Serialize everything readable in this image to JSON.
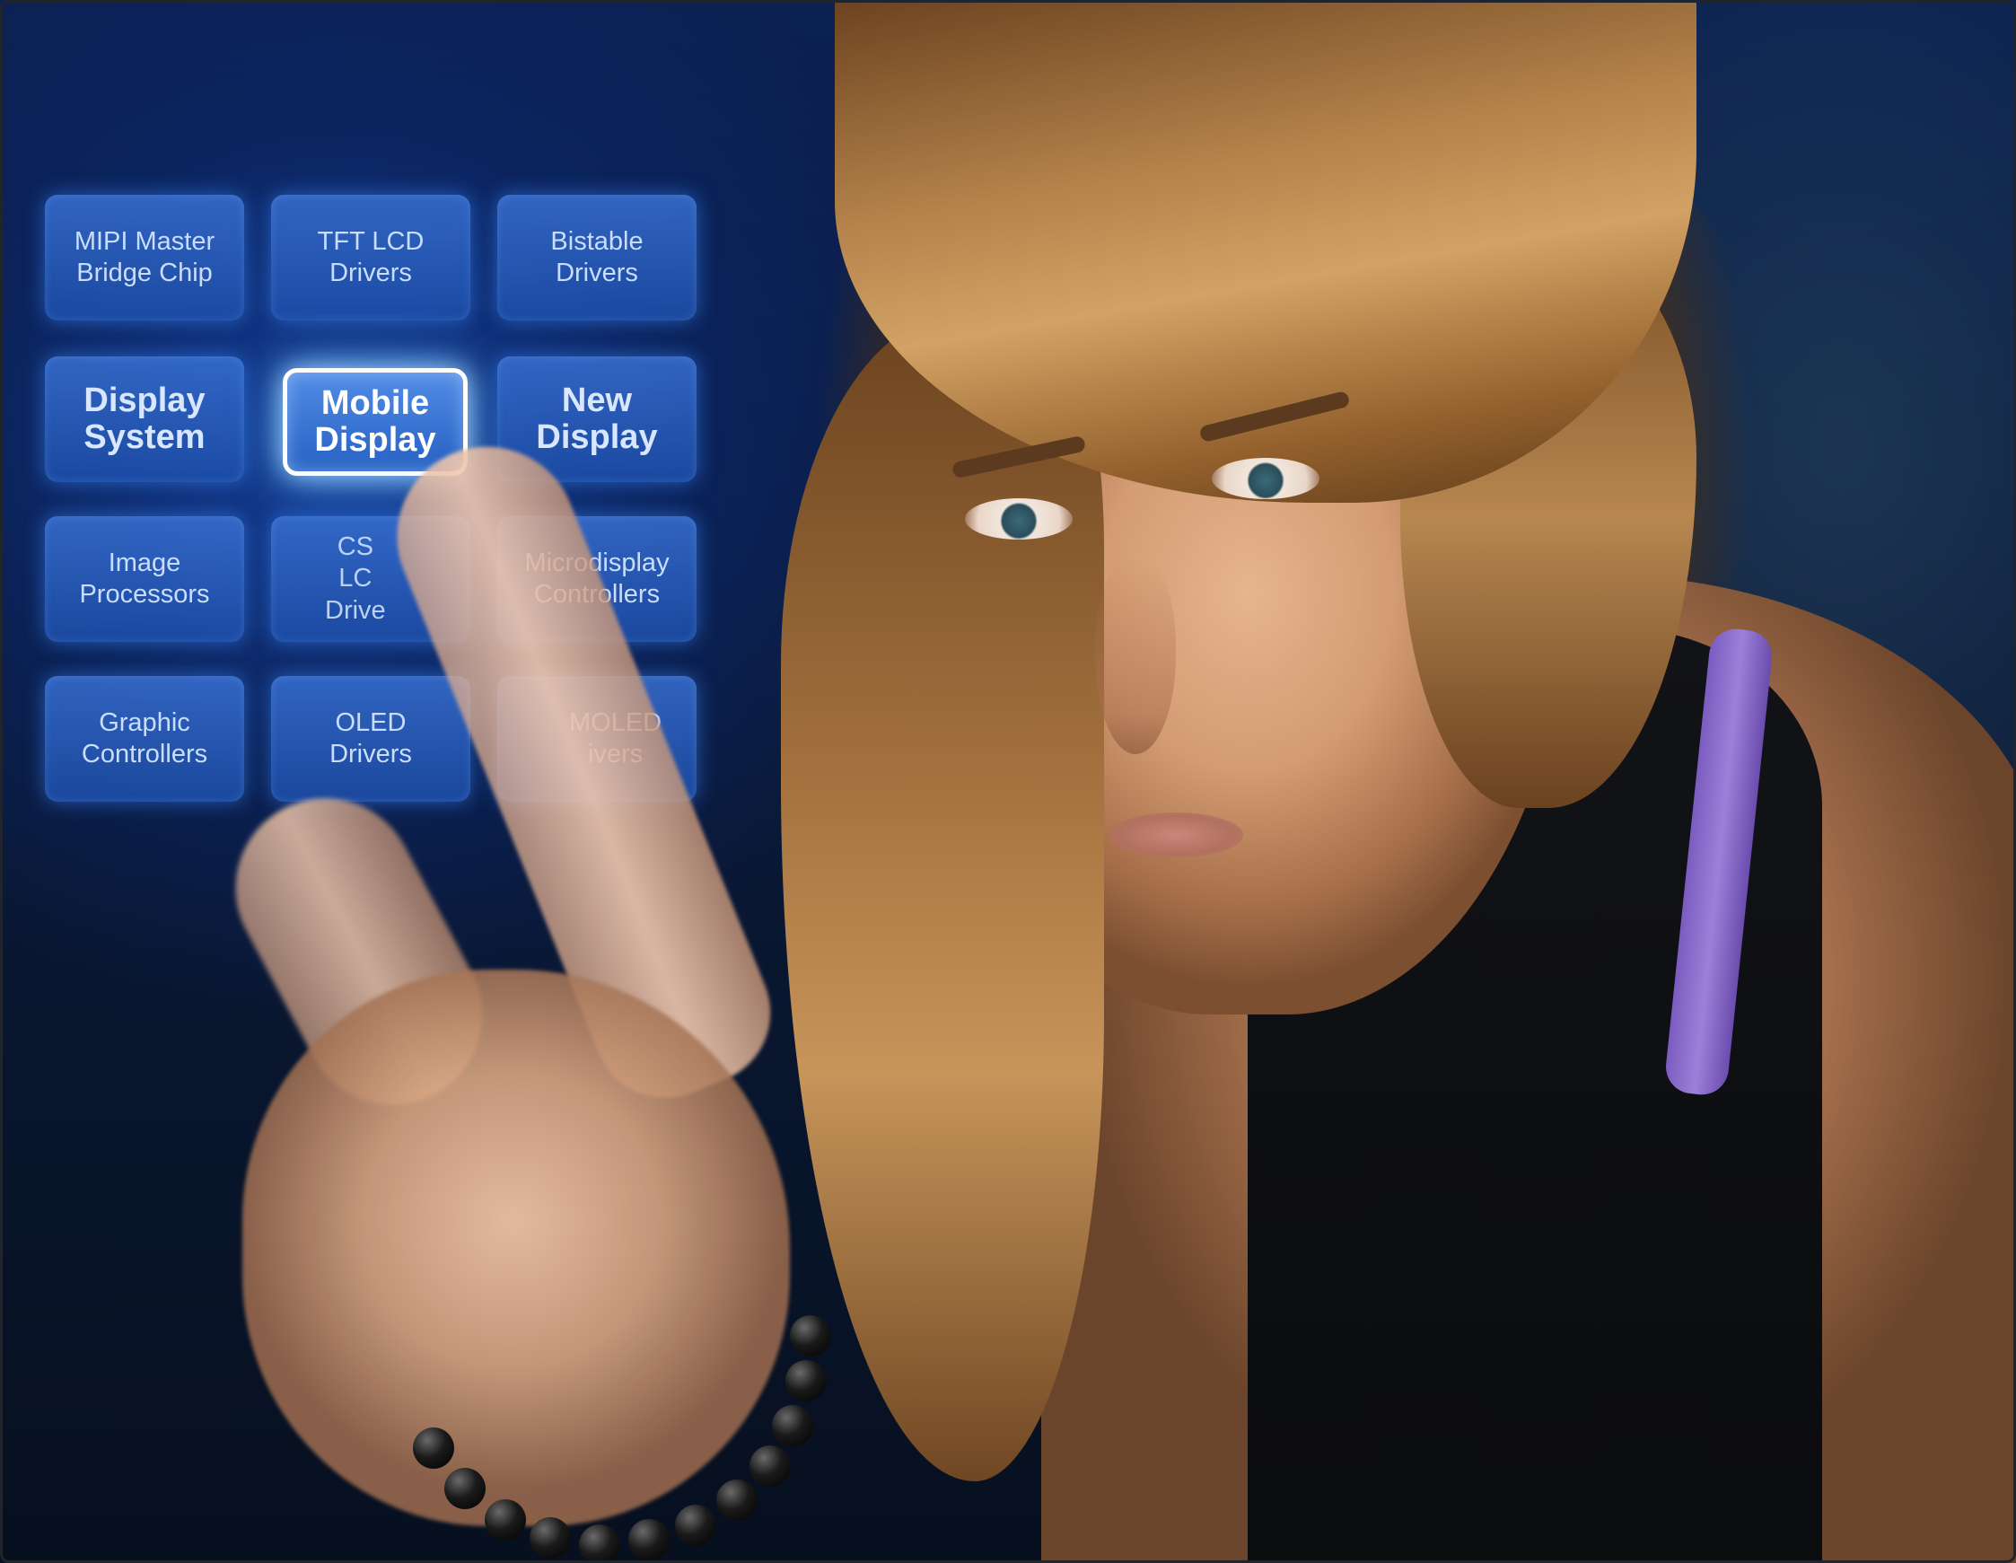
{
  "tiles": [
    {
      "label": "MIPI Master\nBridge Chip",
      "state": "normal"
    },
    {
      "label": "TFT LCD\nDrivers",
      "state": "normal"
    },
    {
      "label": "Bistable\nDrivers",
      "state": "normal"
    },
    {
      "label": "Display\nSystem",
      "state": "large"
    },
    {
      "label": "Mobile\nDisplay",
      "state": "selected"
    },
    {
      "label": "New\nDisplay",
      "state": "large"
    },
    {
      "label": "Image\nProcessors",
      "state": "normal"
    },
    {
      "label": "CS\nLC\nDrive",
      "state": "partially-hidden"
    },
    {
      "label": "Microdisplay\nControllers",
      "state": "normal"
    },
    {
      "label": "Graphic\nControllers",
      "state": "normal"
    },
    {
      "label": "OLED\nDrivers",
      "state": "normal"
    },
    {
      "label": "MOLED\nivers",
      "state": "partially-hidden"
    }
  ],
  "colors": {
    "tile_fill": "#2a5fc0",
    "tile_glow": "#3c8cff",
    "selected_border": "#ffffff",
    "background": "#0b2152"
  }
}
